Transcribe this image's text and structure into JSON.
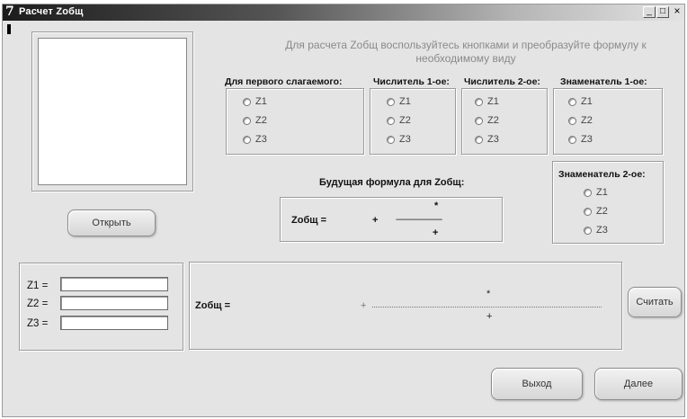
{
  "window": {
    "icon": "7",
    "title": "Расчет Zобщ",
    "min_symbol": "_",
    "max_symbol": "□",
    "close_symbol": "×"
  },
  "hint": "Для расчета Zобщ воспользуйтесь кнопками и преобразуйте формулу к необходимому виду",
  "groups": {
    "first_term": {
      "label": "Для первого слагаемого:",
      "options": [
        "Z1",
        "Z2",
        "Z3"
      ]
    },
    "numerator_1": {
      "label": "Числитель 1-ое:",
      "options": [
        "Z1",
        "Z2",
        "Z3"
      ]
    },
    "numerator_2": {
      "label": "Числитель 2-ое:",
      "options": [
        "Z1",
        "Z2",
        "Z3"
      ]
    },
    "denominator_1": {
      "label": "Знаменатель 1-ое:",
      "options": [
        "Z1",
        "Z2",
        "Z3"
      ]
    },
    "denominator_2": {
      "label": "Знаменатель 2-ое:",
      "options": [
        "Z1",
        "Z2",
        "Z3"
      ]
    }
  },
  "future_formula": {
    "title": "Будущая формула для Zобщ:",
    "lhs": "Zобщ =",
    "plus": "+",
    "star": "*",
    "dashes": "----------------------",
    "plus_bottom": "+"
  },
  "buttons": {
    "open": "Открыть",
    "calculate": "Считать",
    "exit": "Выход",
    "next": "Далее"
  },
  "inputs": [
    {
      "label": "Z1 =",
      "value": ""
    },
    {
      "label": "Z2 =",
      "value": ""
    },
    {
      "label": "Z3 =",
      "value": ""
    }
  ],
  "result": {
    "lhs": "Zобщ =",
    "plus": "+",
    "star": "*",
    "plus_bottom": "+"
  }
}
